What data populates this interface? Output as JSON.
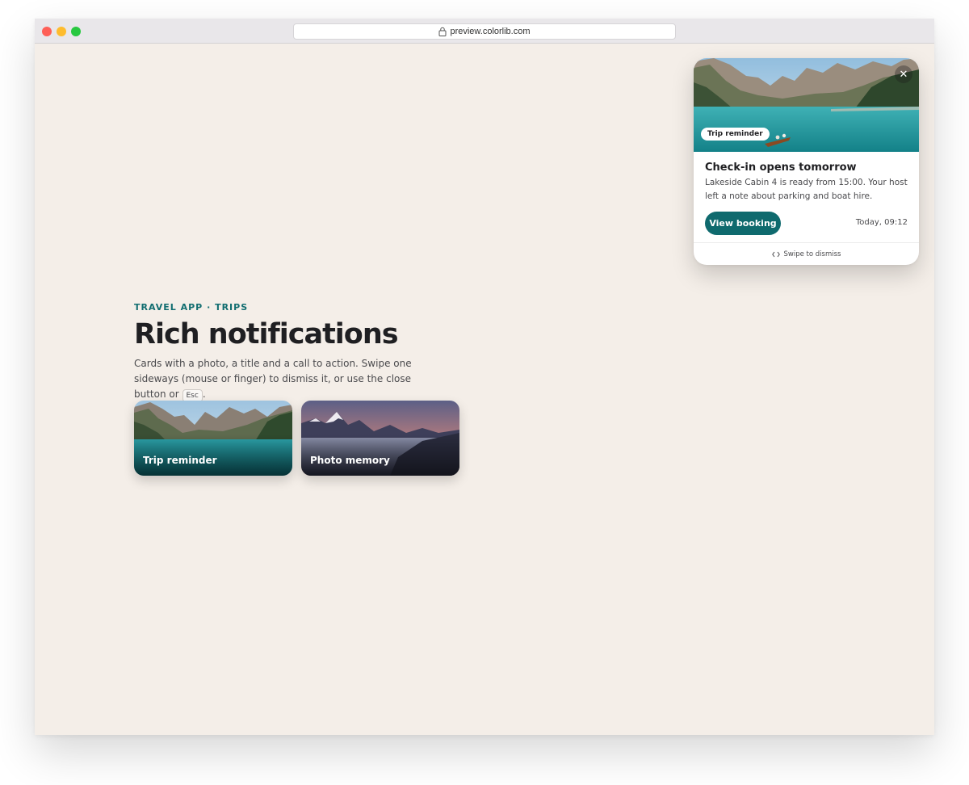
{
  "browser": {
    "url": "preview.colorlib.com"
  },
  "hero": {
    "eyebrow": "TRAVEL APP · TRIPS",
    "title": "Rich notifications",
    "desc_before": "Cards with a photo, a title and a call to action. Swipe one sideways (mouse or finger) to dismiss it, or use the close button or",
    "key": "Esc",
    "desc_after": "."
  },
  "cards": [
    {
      "label": "Trip reminder"
    },
    {
      "label": "Photo memory"
    }
  ],
  "notification": {
    "chip": "Trip reminder",
    "title": "Check-in opens tomorrow",
    "body": "Lakeside Cabin 4 is ready from 15:00. Your host left a note about parking and boat hire.",
    "action": "View booking",
    "time": "Today, 09:12",
    "footer": "Swipe to dismiss"
  },
  "colors": {
    "accent": "#0f6a6e",
    "page_bg": "#f4eee8"
  }
}
